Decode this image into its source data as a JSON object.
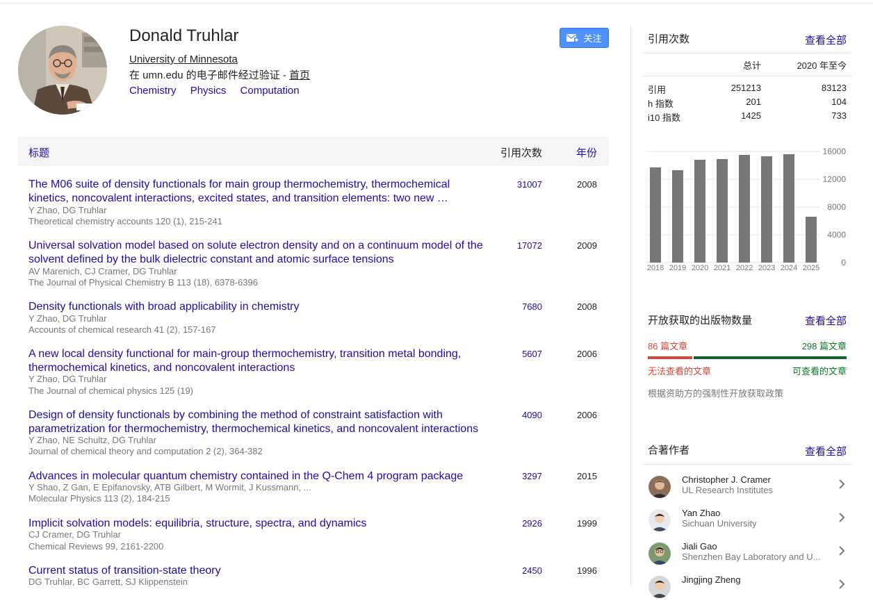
{
  "profile": {
    "name": "Donald Truhlar",
    "affiliation": "University of Minnesota",
    "email_verified": "在 umn.edu 的电子邮件经过验证 - ",
    "homepage_label": "首页",
    "interests": [
      "Chemistry",
      "Physics",
      "Computation"
    ],
    "follow_label": "关注"
  },
  "table": {
    "header_title": "标题",
    "header_cited": "引用次数",
    "header_year": "年份",
    "rows": [
      {
        "title": "The M06 suite of density functionals for main group thermochemistry, thermochemical kinetics, noncovalent interactions, excited states, and transition elements: two new …",
        "authors": "Y Zhao, DG Truhlar",
        "venue": "Theoretical chemistry accounts 120 (1), 215-241",
        "cited": "31007",
        "year": "2008"
      },
      {
        "title": "Universal solvation model based on solute electron density and on a continuum model of the solvent defined by the bulk dielectric constant and atomic surface tensions",
        "authors": "AV Marenich, CJ Cramer, DG Truhlar",
        "venue": "The Journal of Physical Chemistry B 113 (18), 6378-6396",
        "cited": "17072",
        "year": "2009"
      },
      {
        "title": "Density functionals with broad applicability in chemistry",
        "authors": "Y Zhao, DG Truhlar",
        "venue": "Accounts of chemical research 41 (2), 157-167",
        "cited": "7680",
        "year": "2008"
      },
      {
        "title": "A new local density functional for main-group thermochemistry, transition metal bonding, thermochemical kinetics, and noncovalent interactions",
        "authors": "Y Zhao, DG Truhlar",
        "venue": "The Journal of chemical physics 125 (19)",
        "cited": "5607",
        "year": "2006"
      },
      {
        "title": "Design of density functionals by combining the method of constraint satisfaction with parametrization for thermochemistry, thermochemical kinetics, and noncovalent interactions",
        "authors": "Y Zhao, NE Schultz, DG Truhlar",
        "venue": "Journal of chemical theory and computation 2 (2), 364-382",
        "cited": "4090",
        "year": "2006"
      },
      {
        "title": "Advances in molecular quantum chemistry contained in the Q-Chem 4 program package",
        "authors": "Y Shao, Z Gan, E Epifanovsky, ATB Gilbert, M Wormit, J Kussmann, ...",
        "venue": "Molecular Physics 113 (2), 184-215",
        "cited": "3297",
        "year": "2015"
      },
      {
        "title": "Implicit solvation models: equilibria, structure, spectra, and dynamics",
        "authors": "CJ Cramer, DG Truhlar",
        "venue": "Chemical Reviews 99, 2161-2200",
        "cited": "2926",
        "year": "1999"
      },
      {
        "title": "Current status of transition-state theory",
        "authors": "DG Truhlar, BC Garrett, SJ Klippenstein",
        "venue": "",
        "cited": "2450",
        "year": "1996"
      }
    ]
  },
  "citations": {
    "heading": "引用次数",
    "view_all": "查看全部",
    "col_total": "总计",
    "col_since": "2020 年至今",
    "rows": [
      {
        "label": "引用",
        "total": "251213",
        "since": "83123"
      },
      {
        "label": "h 指数",
        "total": "201",
        "since": "104"
      },
      {
        "label": "i10 指数",
        "total": "1425",
        "since": "733"
      }
    ]
  },
  "chart_data": {
    "type": "bar",
    "categories": [
      "2018",
      "2019",
      "2020",
      "2021",
      "2022",
      "2023",
      "2024",
      "2025"
    ],
    "values": [
      13700,
      13300,
      14800,
      14900,
      15500,
      15300,
      15600,
      6600
    ],
    "yticks": [
      "16000",
      "12000",
      "8000",
      "4000",
      "0"
    ],
    "ylim": [
      0,
      16000
    ],
    "bar_color": "#777777",
    "grid": true,
    "title": "",
    "xlabel": "",
    "ylabel": ""
  },
  "open_access": {
    "heading": "开放获取的出版物数量",
    "view_all": "查看全部",
    "unavailable_count": "86 篇文章",
    "available_count": "298 篇文章",
    "unavailable_fraction": 0.224,
    "unavailable_label": "无法查看的文章",
    "available_label": "可查看的文章",
    "note": "根据资助方的强制性开放获取政策",
    "colors": {
      "unavailable": "#d14836",
      "available": "#0d652d"
    }
  },
  "coauthors": {
    "heading": "合著作者",
    "view_all": "查看全部",
    "items": [
      {
        "name": "Christopher J. Cramer",
        "affiliation": "UL Research Institutes"
      },
      {
        "name": "Yan Zhao",
        "affiliation": "Sichuan University"
      },
      {
        "name": "Jiali Gao",
        "affiliation": "Shenzhen Bay Laboratory and U..."
      },
      {
        "name": "Jingjing Zheng",
        "affiliation": ""
      }
    ]
  },
  "colors": {
    "link": "#1a0dab",
    "follow_button": "#4d90fe"
  },
  "icons": {
    "follow": "mail-plus-icon",
    "coauthor_open": "chevron-right-icon"
  }
}
